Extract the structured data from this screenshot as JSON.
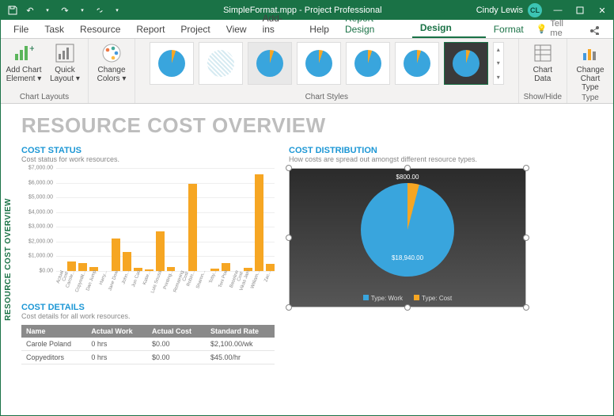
{
  "titlebar": {
    "doc": "SimpleFormat.mpp  -  Project Professional",
    "user": "Cindy Lewis",
    "initials": "CL"
  },
  "tabs": [
    "File",
    "Task",
    "Resource",
    "Report",
    "Project",
    "View",
    "Add-ins",
    "Help",
    "Report Design",
    "Chart Design",
    "Format"
  ],
  "tabs_active": 9,
  "tabs_context_start": 8,
  "tellme": "Tell me",
  "ribbon": {
    "chart_layouts": {
      "label": "Chart Layouts",
      "add_chart_element": "Add Chart Element ▾",
      "quick_layout": "Quick Layout ▾",
      "change_colors": "Change Colors ▾"
    },
    "chart_styles": {
      "label": "Chart Styles"
    },
    "show_hide": {
      "label": "Show/Hide",
      "chart_data": "Chart Data"
    },
    "type": {
      "label": "Type",
      "change_chart_type": "Change Chart Type"
    }
  },
  "report": {
    "title": "RESOURCE COST OVERVIEW",
    "side_label": "RESOURCE COST OVERVIEW",
    "cost_status": {
      "title": "COST STATUS",
      "sub": "Cost status for work resources."
    },
    "cost_distribution": {
      "title": "COST DISTRIBUTION",
      "sub": "How costs are spread out amongst different resource types."
    },
    "cost_details": {
      "title": "COST DETAILS",
      "sub": "Cost details for all work resources."
    }
  },
  "table": {
    "headers": [
      "Name",
      "Actual Work",
      "Actual Cost",
      "Standard Rate"
    ],
    "rows": [
      [
        "Carole Poland",
        "0 hrs",
        "$0.00",
        "$2,100.00/wk"
      ],
      [
        "Copyeditors",
        "0 hrs",
        "$0.00",
        "$45.00/hr"
      ]
    ]
  },
  "pie": {
    "work_label": "$18,940.00",
    "cost_label": "$800.00",
    "legend_work": "Type: Work",
    "legend_cost": "Type: Cost"
  },
  "chart_data": [
    {
      "type": "bar",
      "title": "COST STATUS",
      "ylabel": "",
      "ylim": [
        0,
        7000
      ],
      "yticks": [
        "$0.00",
        "$1,000.00",
        "$2,000.00",
        "$3,000.00",
        "$4,000.00",
        "$5,000.00",
        "$6,000.00",
        "$7,000.00"
      ],
      "categories": [
        "Actual Cost",
        "Carole...",
        "Copyedit...",
        "Dan Jump",
        "Hany...",
        "Jane Dow",
        "John...",
        "Jun Cao",
        "Katie...",
        "Luis Sousa",
        "Printing...",
        "Remaining Cost",
        "Robin...",
        "Sharon...",
        "Toby...",
        "Toni Poe",
        "Baseline Cost",
        "Vikas Jain",
        "William...",
        "Zac..."
      ],
      "values": [
        0,
        670,
        520,
        280,
        0,
        2210,
        1290,
        220,
        120,
        2685,
        270,
        0,
        5900,
        0,
        180,
        530,
        0,
        210,
        6580,
        490
      ]
    },
    {
      "type": "pie",
      "title": "COST DISTRIBUTION",
      "series": [
        {
          "name": "Type: Work",
          "value": 18940.0
        },
        {
          "name": "Type: Cost",
          "value": 800.0
        }
      ],
      "colors": [
        "#39a5dd",
        "#f6a623"
      ]
    }
  ]
}
